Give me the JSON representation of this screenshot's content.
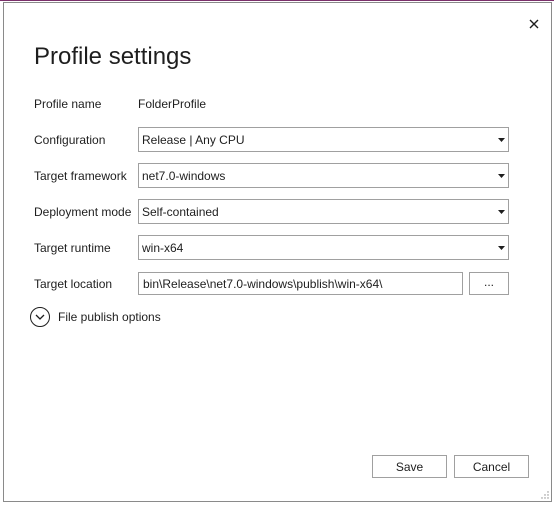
{
  "dialog": {
    "title": "Profile settings",
    "close_icon": "close-icon"
  },
  "form": {
    "profile_name": {
      "label": "Profile name",
      "value": "FolderProfile"
    },
    "configuration": {
      "label": "Configuration",
      "value": "Release | Any CPU"
    },
    "target_framework": {
      "label": "Target framework",
      "value": "net7.0-windows"
    },
    "deployment_mode": {
      "label": "Deployment mode",
      "value": "Self-contained"
    },
    "target_runtime": {
      "label": "Target runtime",
      "value": "win-x64"
    },
    "target_location": {
      "label": "Target location",
      "value": "bin\\Release\\net7.0-windows\\publish\\win-x64\\",
      "browse_label": "..."
    }
  },
  "expander": {
    "label": "File publish options",
    "icon": "chevron-down-circle-icon"
  },
  "footer": {
    "save_label": "Save",
    "cancel_label": "Cancel"
  }
}
